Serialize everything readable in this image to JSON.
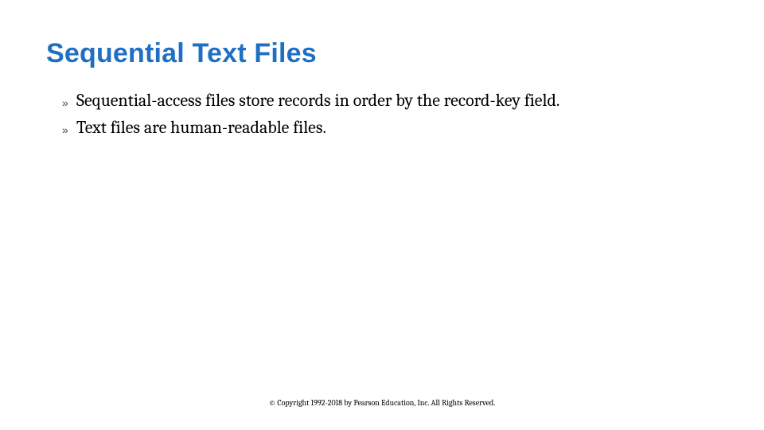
{
  "slide": {
    "title": "Sequential Text Files",
    "bullets": [
      "Sequential-access files store records in order by the record-key field.",
      "Text files are human-readable files."
    ],
    "footer": "© Copyright 1992-2018 by Pearson Education, Inc. All Rights Reserved."
  },
  "icons": {
    "bullet_glyph": "»"
  }
}
